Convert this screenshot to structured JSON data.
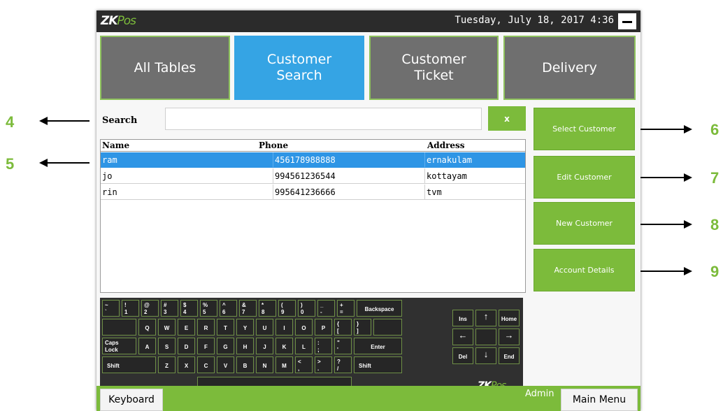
{
  "app": {
    "logo_zk": "ZK",
    "logo_pos": "Pos",
    "datetime": "Tuesday, July 18, 2017 4:36"
  },
  "tabs": [
    {
      "label_line1": "All Tables",
      "label_line2": ""
    },
    {
      "label_line1": "Customer",
      "label_line2": "Search"
    },
    {
      "label_line1": "Customer",
      "label_line2": "Ticket"
    },
    {
      "label_line1": "Delivery",
      "label_line2": ""
    }
  ],
  "search": {
    "label": "Search",
    "value": "",
    "clear_label": "x"
  },
  "table": {
    "headers": [
      "Name",
      "Phone",
      "Address"
    ],
    "rows": [
      {
        "name": "ram",
        "phone": "456178988888",
        "address": "ernakulam",
        "selected": true
      },
      {
        "name": "jo",
        "phone": "994561236544",
        "address": "kottayam",
        "selected": false
      },
      {
        "name": "rin",
        "phone": "995641236666",
        "address": "tvm",
        "selected": false
      }
    ]
  },
  "actions": {
    "select_customer": "Select Customer",
    "edit_customer": "Edit Customer",
    "new_customer": "New Customer",
    "account_details": "Account Details"
  },
  "keyboard": {
    "row1": [
      {
        "top": "~",
        "bottom": "`"
      },
      {
        "top": "!",
        "bottom": "1"
      },
      {
        "top": "@",
        "bottom": "2"
      },
      {
        "top": "#",
        "bottom": "3"
      },
      {
        "top": "$",
        "bottom": "4"
      },
      {
        "top": "%",
        "bottom": "5"
      },
      {
        "top": "^",
        "bottom": "6"
      },
      {
        "top": "&",
        "bottom": "7"
      },
      {
        "top": "*",
        "bottom": "8"
      },
      {
        "top": "(",
        "bottom": "9"
      },
      {
        "top": ")",
        "bottom": "0"
      },
      {
        "top": "_",
        "bottom": "-"
      },
      {
        "top": "+",
        "bottom": "="
      }
    ],
    "backspace": "Backspace",
    "row2": [
      "Q",
      "W",
      "E",
      "R",
      "T",
      "Y",
      "U",
      "I",
      "O",
      "P"
    ],
    "row2_brackets": [
      {
        "top": "{",
        "bottom": "["
      },
      {
        "top": "}",
        "bottom": "]"
      }
    ],
    "caps_top": "Caps",
    "caps_bottom": "Lock",
    "row3": [
      "A",
      "S",
      "D",
      "F",
      "G",
      "H",
      "J",
      "K",
      "L"
    ],
    "row3_punct": [
      {
        "top": ":",
        "bottom": ";"
      },
      {
        "top": "\"",
        "bottom": "'"
      }
    ],
    "enter": "Enter",
    "shift": "Shift",
    "row4": [
      "Z",
      "X",
      "C",
      "V",
      "B",
      "N",
      "M"
    ],
    "row4_punct": [
      {
        "top": "<",
        "bottom": ","
      },
      {
        "top": ">",
        "bottom": "."
      },
      {
        "top": "?",
        "bottom": "/"
      }
    ],
    "ins": "Ins",
    "home": "Home",
    "del": "Del",
    "end": "End",
    "arrow_up": "↑",
    "arrow_down": "↓",
    "arrow_left": "←",
    "arrow_right": "→",
    "logo_zk": "ZK",
    "logo_pos": "Pos"
  },
  "statusbar": {
    "keyboard_label": "Keyboard",
    "user": "Admin",
    "main_menu_label": "Main Menu"
  },
  "callouts": [
    "4",
    "5",
    "6",
    "7",
    "8",
    "9"
  ],
  "colors": {
    "accent_green": "#7cbb3b",
    "active_tab_blue": "#35a4e4",
    "selected_row_blue": "#2e95e5",
    "inactive_tab_gray": "#6f6f6f"
  }
}
